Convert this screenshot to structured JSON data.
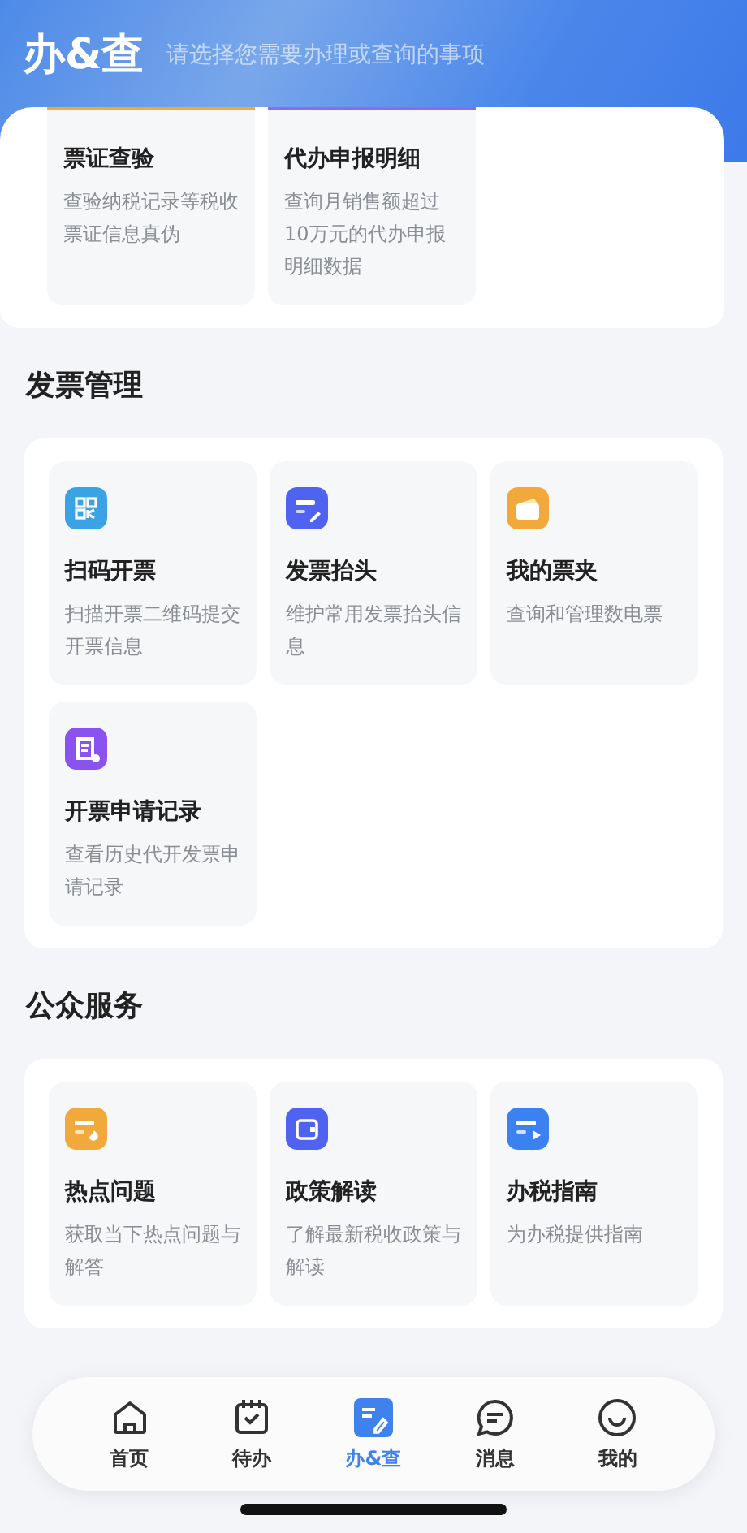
{
  "header": {
    "title": "办&查",
    "subtitle": "请选择您需要办理或查询的事项"
  },
  "sections": [
    {
      "items": [
        {
          "kind": "cut",
          "title": "票证查验",
          "desc": "查验纳税记录等税收票证信息真伪",
          "color": "#f2a93b"
        },
        {
          "kind": "cut",
          "title": "代办申报明细",
          "desc": "查询月销售额超过10万元的代办申报明细数据",
          "color": "#8b6cf0"
        }
      ]
    },
    {
      "title": "发票管理",
      "items": [
        {
          "kind": "qr",
          "title": "扫码开票",
          "desc": "扫描开票二维码提交开票信息",
          "color": "#3aa3e6"
        },
        {
          "kind": "pen",
          "title": "发票抬头",
          "desc": "维护常用发票抬头信息",
          "color": "#4f63f0"
        },
        {
          "kind": "folder",
          "title": "我的票夹",
          "desc": "查询和管理数电票",
          "color": "#f2a93b"
        },
        {
          "kind": "ticket",
          "title": "开票申请记录",
          "desc": "查看历史代开发票申请记录",
          "color": "#8a52ee"
        }
      ]
    },
    {
      "title": "公众服务",
      "items": [
        {
          "kind": "hot",
          "title": "热点问题",
          "desc": "获取当下热点问题与解答",
          "color": "#f2a93b"
        },
        {
          "kind": "wallet",
          "title": "政策解读",
          "desc": "了解最新税收政策与解读",
          "color": "#4f63f0"
        },
        {
          "kind": "play",
          "title": "办税指南",
          "desc": "为办税提供指南",
          "color": "#3b82f0"
        }
      ]
    }
  ],
  "tabs": [
    {
      "kind": "home",
      "label": "首页",
      "selected": false
    },
    {
      "kind": "todo",
      "label": "待办",
      "selected": false
    },
    {
      "kind": "query",
      "label": "办&查",
      "selected": true
    },
    {
      "kind": "msg",
      "label": "消息",
      "selected": false
    },
    {
      "kind": "me",
      "label": "我的",
      "selected": false
    }
  ]
}
